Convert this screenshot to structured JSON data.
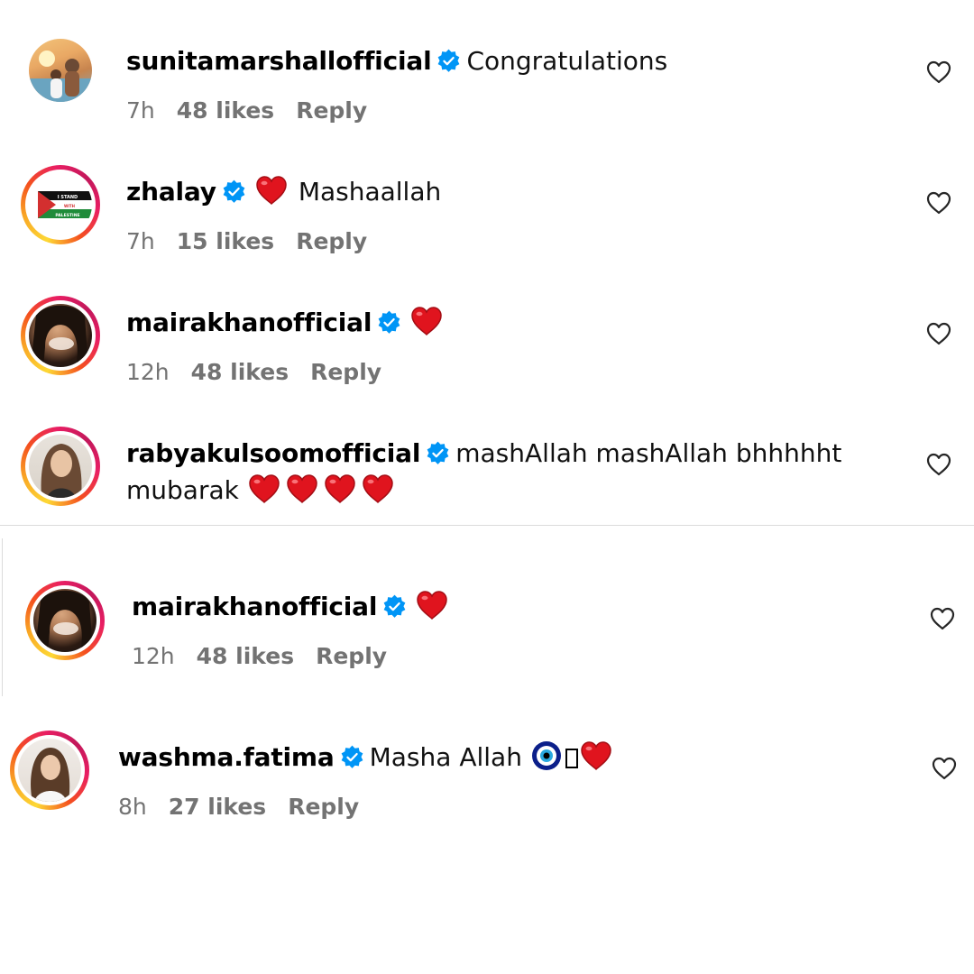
{
  "comments": [
    {
      "username": "sunitamarshallofficial",
      "text": "Congratulations",
      "time": "7h",
      "likes": "48 likes",
      "reply": "Reply"
    },
    {
      "username": "zhalay",
      "text": "Mashaallah",
      "time": "7h",
      "likes": "15 likes",
      "reply": "Reply",
      "avatar_text": [
        "I STAND",
        "WITH",
        "PALESTINE"
      ]
    },
    {
      "username": "mairakhanofficial",
      "text": "",
      "time": "12h",
      "likes": "48 likes",
      "reply": "Reply"
    },
    {
      "username": "rabyakulsoomofficial",
      "text": "mashAllah mashAllah bhhhhht",
      "text2": "mubarak"
    },
    {
      "username": "mairakhanofficial",
      "text": "",
      "time": "12h",
      "likes": "48 likes",
      "reply": "Reply"
    },
    {
      "username": "washma.fatima",
      "text": "Masha Allah",
      "time": "8h",
      "likes": "27 likes",
      "reply": "Reply"
    }
  ],
  "colors": {
    "verified": "#0095f6",
    "heart": "#e0141e",
    "meta": "#737373"
  }
}
